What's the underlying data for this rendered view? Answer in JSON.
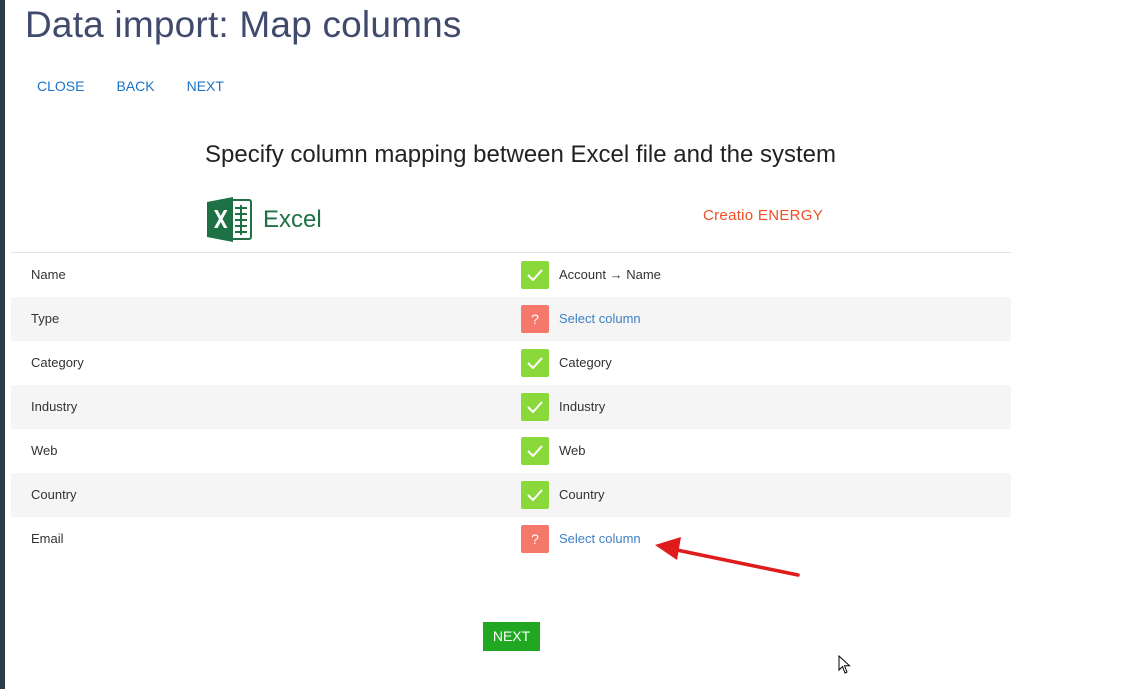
{
  "page": {
    "title": "Data import: Map columns"
  },
  "toolbar": {
    "close_label": "CLOSE",
    "back_label": "BACK",
    "next_label": "NEXT"
  },
  "subtitle": "Specify column mapping between Excel file and the system",
  "logos": {
    "excel": "Excel",
    "creatio": "Creatio ENERGY"
  },
  "mapping": {
    "rows": [
      {
        "source": "Name",
        "status": "mapped",
        "target": "Account → Name"
      },
      {
        "source": "Type",
        "status": "unmapped",
        "target": "Select column"
      },
      {
        "source": "Category",
        "status": "mapped",
        "target": "Category"
      },
      {
        "source": "Industry",
        "status": "mapped",
        "target": "Industry"
      },
      {
        "source": "Web",
        "status": "mapped",
        "target": "Web"
      },
      {
        "source": "Country",
        "status": "mapped",
        "target": "Country"
      },
      {
        "source": "Email",
        "status": "unmapped",
        "target": "Select column"
      }
    ]
  },
  "status_icons": {
    "mapped": "checkmark-icon",
    "unmapped": "question-mark-icon",
    "unmapped_glyph": "?"
  },
  "footer": {
    "next_label": "NEXT"
  },
  "colors": {
    "link": "#1a73c9",
    "mapped": "#8bd83a",
    "unmapped": "#f5796b",
    "next_button": "#22a722",
    "annotation": "#e01b1b",
    "creatio_brand": "#f04e23",
    "excel_brand": "#1e7145"
  }
}
